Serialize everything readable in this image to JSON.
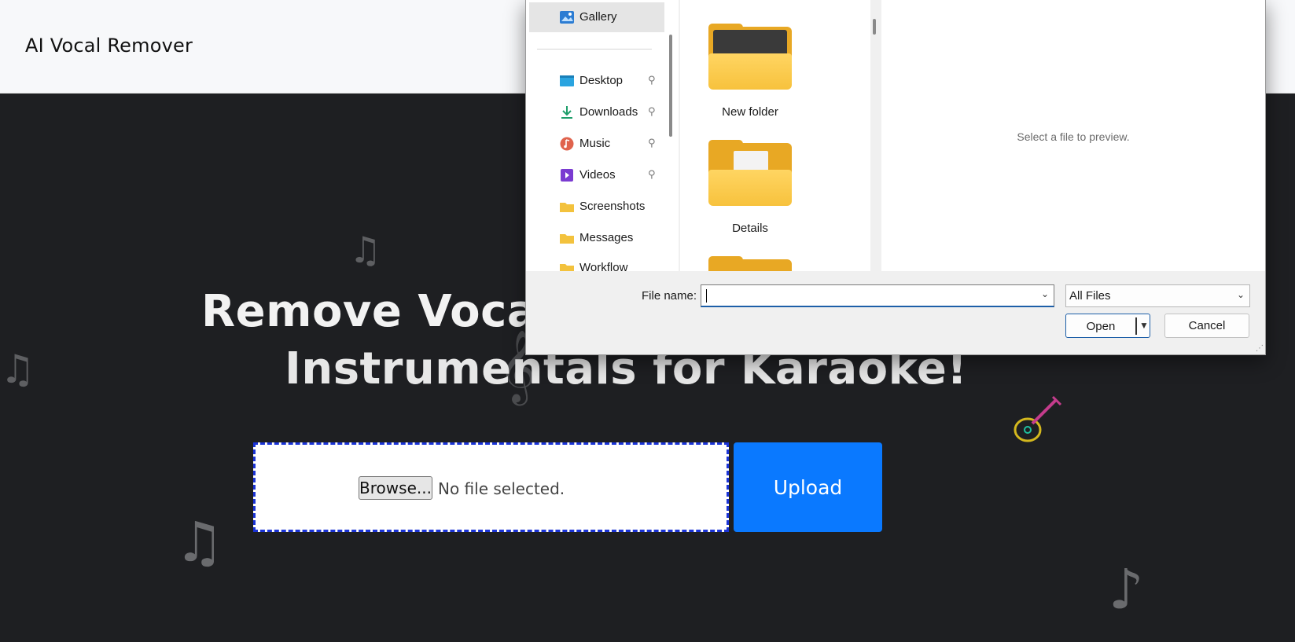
{
  "site": {
    "brand": "AI Vocal Remover",
    "headline_line1": "Remove Vocals",
    "headline_line2": "Instrumentals for Karaoke!",
    "browse_label": "Browse...",
    "no_file_text": "No file selected.",
    "upload_label": "Upload",
    "accent_color": "#0a79ff",
    "dropzone_border_color": "#1a33d6"
  },
  "decorations": {
    "notes_double": "♫",
    "note_single": "♪",
    "note_eighth": "♫",
    "clef": "𝄞",
    "guitar_icon": "guitar-icon"
  },
  "file_dialog": {
    "nav": {
      "items": [
        {
          "label": "Gallery",
          "icon": "gallery-icon",
          "pinned": false,
          "selected": true
        },
        {
          "label": "Desktop",
          "icon": "desktop-icon",
          "pinned": true
        },
        {
          "label": "Downloads",
          "icon": "downloads-icon",
          "pinned": true
        },
        {
          "label": "Music",
          "icon": "music-icon",
          "pinned": true
        },
        {
          "label": "Videos",
          "icon": "videos-icon",
          "pinned": true
        },
        {
          "label": "Screenshots",
          "icon": "folder-icon",
          "pinned": false
        },
        {
          "label": "Messages",
          "icon": "folder-icon",
          "pinned": false
        },
        {
          "label": "Workflow",
          "icon": "folder-icon",
          "pinned": false
        }
      ],
      "pin_glyph": "📌"
    },
    "folders": [
      {
        "name": "New folder"
      },
      {
        "name": "Details"
      }
    ],
    "preview_text": "Select a file to preview.",
    "file_name_label": "File name:",
    "file_name_value": "",
    "filter_value": "All Files",
    "open_label": "Open",
    "cancel_label": "Cancel",
    "dropdown_glyph": "⌄"
  }
}
